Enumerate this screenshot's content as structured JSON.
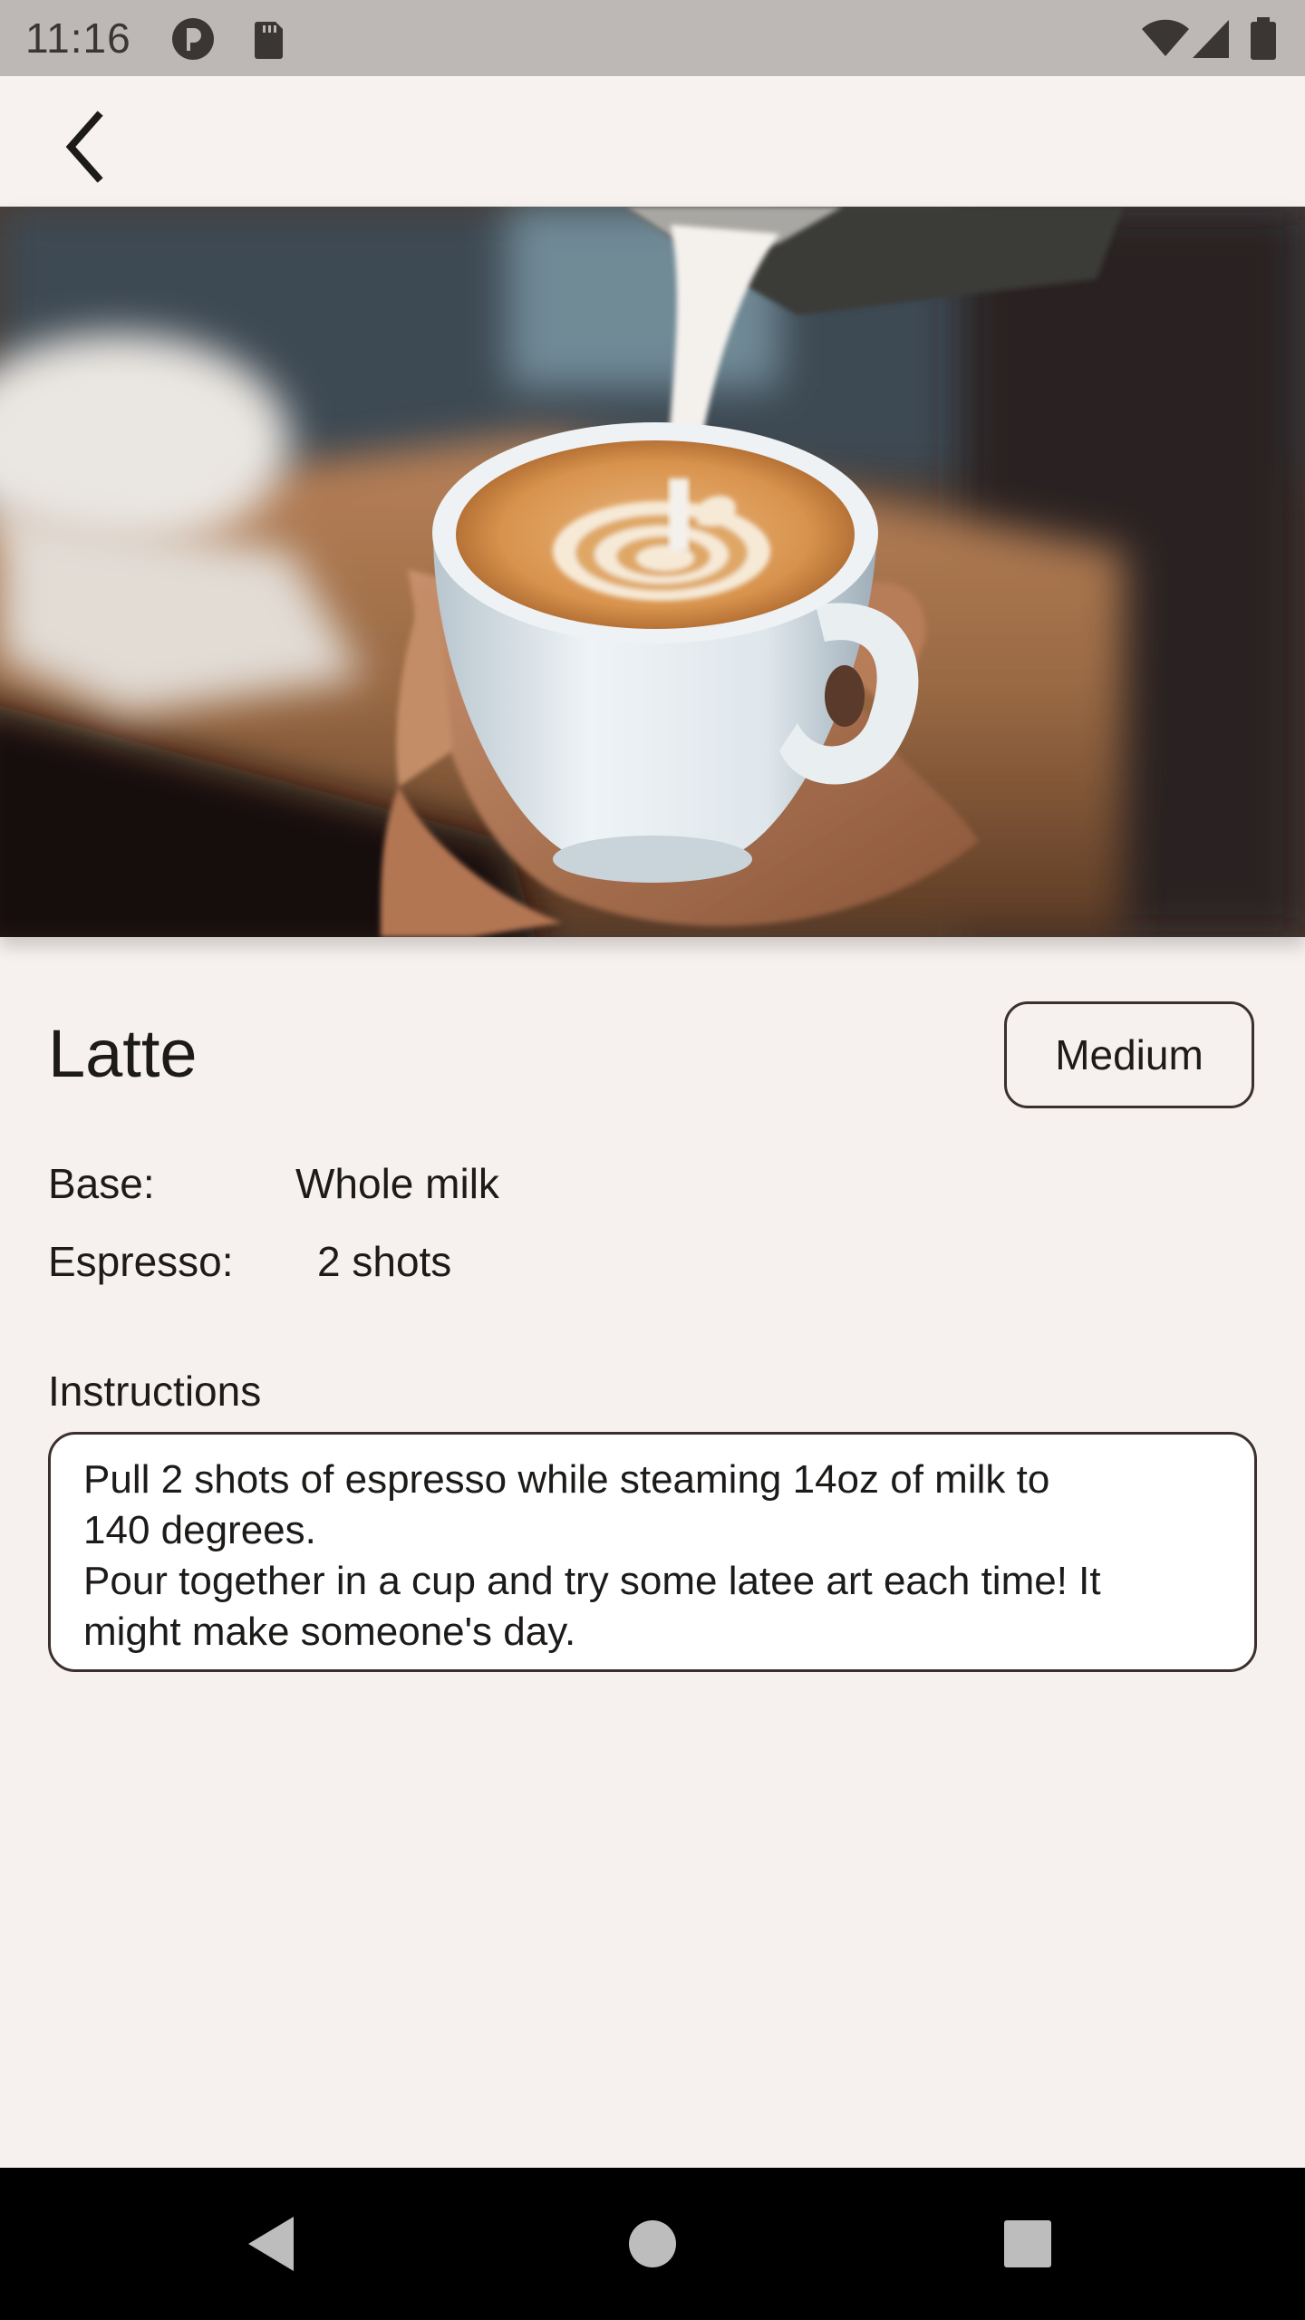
{
  "status_bar": {
    "time": "11:16",
    "icons": [
      "circle-p-icon",
      "sd-card-icon",
      "wifi-icon",
      "signal-icon",
      "battery-icon"
    ]
  },
  "app_bar": {
    "back_icon": "chevron-left-icon"
  },
  "hero_image": {
    "subject": "latte-art-photo"
  },
  "drink": {
    "name": "Latte",
    "size": "Medium",
    "details": [
      {
        "label": "Base:",
        "value": "Whole milk"
      },
      {
        "label": "Espresso:",
        "value": "2 shots"
      }
    ],
    "instructions_label": "Instructions",
    "instructions": "Pull 2 shots of espresso while steaming 14oz of milk to\n140 degrees.\nPour together in a cup and try some latee art each time! It\nmight make someone's day."
  },
  "nav_bar": {
    "icons": [
      "back-triangle-icon",
      "home-circle-icon",
      "recents-square-icon"
    ]
  },
  "colors": {
    "background": "#f6f1ee",
    "status_bar": "#bdb8b5",
    "outline": "#3a302d",
    "nav_bar": "#000000"
  }
}
